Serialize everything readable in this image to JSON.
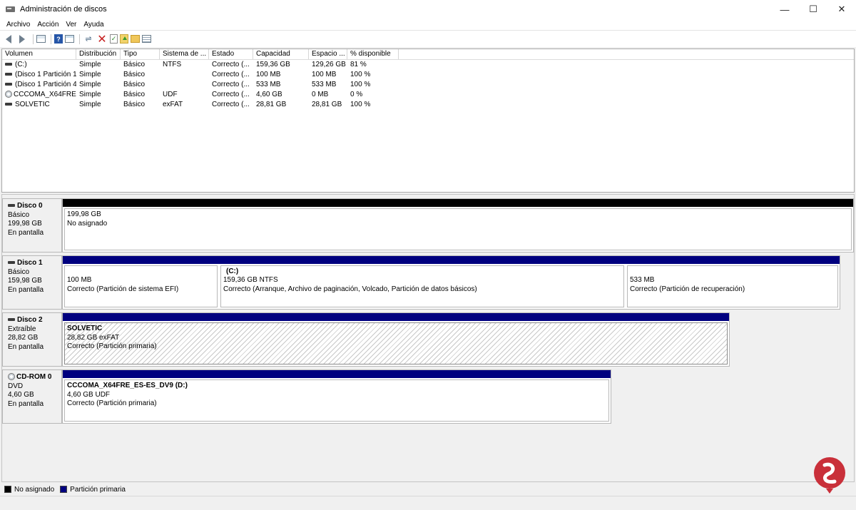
{
  "window": {
    "title": "Administración de discos",
    "minimize": "—",
    "maximize": "☐",
    "close": "✕"
  },
  "menu": [
    "Archivo",
    "Acción",
    "Ver",
    "Ayuda"
  ],
  "volume_list": {
    "columns": [
      "Volumen",
      "Distribución",
      "Tipo",
      "Sistema de ...",
      "Estado",
      "Capacidad",
      "Espacio ...",
      "% disponible"
    ],
    "rows": [
      {
        "volume": "(C:)",
        "dist": "Simple",
        "tipo": "Básico",
        "fs": "NTFS",
        "estado": "Correcto (...",
        "capacidad": "159,36 GB",
        "espacio": "129,26 GB",
        "pct": "81 %",
        "icon": "drive-icon"
      },
      {
        "volume": "(Disco 1 Partición 1)",
        "dist": "Simple",
        "tipo": "Básico",
        "fs": "",
        "estado": "Correcto (...",
        "capacidad": "100 MB",
        "espacio": "100 MB",
        "pct": "100 %",
        "icon": "drive-icon"
      },
      {
        "volume": "(Disco 1 Partición 4)",
        "dist": "Simple",
        "tipo": "Básico",
        "fs": "",
        "estado": "Correcto (...",
        "capacidad": "533 MB",
        "espacio": "533 MB",
        "pct": "100 %",
        "icon": "drive-icon"
      },
      {
        "volume": "CCCOMA_X64FRE...",
        "dist": "Simple",
        "tipo": "Básico",
        "fs": "UDF",
        "estado": "Correcto (...",
        "capacidad": "4,60 GB",
        "espacio": "0 MB",
        "pct": "0 %",
        "icon": "cd-icon"
      },
      {
        "volume": "SOLVETIC",
        "dist": "Simple",
        "tipo": "Básico",
        "fs": "exFAT",
        "estado": "Correcto (...",
        "capacidad": "28,81 GB",
        "espacio": "28,81 GB",
        "pct": "100 %",
        "icon": "drive-icon"
      }
    ]
  },
  "disks": [
    {
      "name": "Disco 0",
      "type": "Básico",
      "size": "199,98 GB",
      "status": "En pantalla",
      "partitions": [
        {
          "title": "",
          "line1": "199,98 GB",
          "line2": "No asignado",
          "kind": "unallocated"
        }
      ]
    },
    {
      "name": "Disco 1",
      "type": "Básico",
      "size": "159,98 GB",
      "status": "En pantalla",
      "partitions": [
        {
          "title": "",
          "line1": "100 MB",
          "line2": "Correcto (Partición de sistema EFI)",
          "kind": "primary"
        },
        {
          "title": "(C:)",
          "line1": "159,36 GB NTFS",
          "line2": "Correcto (Arranque, Archivo de paginación, Volcado, Partición de datos básicos)",
          "kind": "primary"
        },
        {
          "title": "",
          "line1": "533 MB",
          "line2": "Correcto (Partición de recuperación)",
          "kind": "primary"
        }
      ]
    },
    {
      "name": "Disco 2",
      "type": "Extraíble",
      "size": "28,82 GB",
      "status": "En pantalla",
      "partitions": [
        {
          "title": "SOLVETIC",
          "line1": "28,82 GB exFAT",
          "line2": "Correcto (Partición primaria)",
          "kind": "primary"
        }
      ]
    },
    {
      "name": "CD-ROM 0",
      "type": "DVD",
      "size": "4,60 GB",
      "status": "En pantalla",
      "partitions": [
        {
          "title": "CCCOMA_X64FRE_ES-ES_DV9  (D:)",
          "line1": "4,60 GB UDF",
          "line2": "Correcto (Partición primaria)",
          "kind": "primary"
        }
      ]
    }
  ],
  "legend": [
    {
      "label": "No asignado",
      "color": "#000000"
    },
    {
      "label": "Partición primaria",
      "color": "#00007f"
    }
  ],
  "colors": {
    "unallocated": "#000000",
    "primary": "#00007f"
  }
}
